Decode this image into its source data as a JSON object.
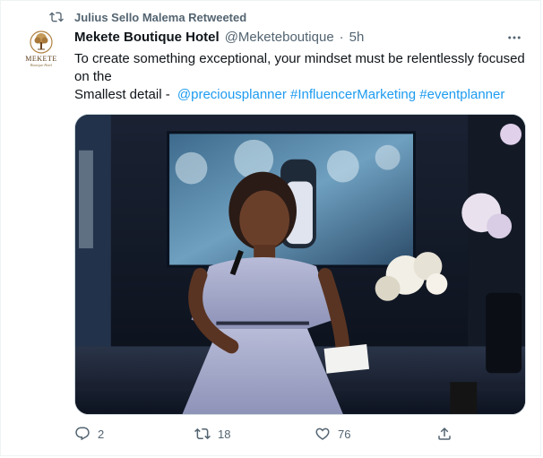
{
  "retweet": {
    "label": "Julius Sello Malema Retweeted",
    "icon": "retweet-icon"
  },
  "tweet": {
    "avatar": {
      "brand": "MEKETE",
      "subtitle": "Boutique Hotel"
    },
    "author_name": "Mekete Boutique Hotel",
    "author_handle": "@Meketeboutique",
    "separator": "·",
    "time": "5h",
    "more_icon": "more-horizontal-icon",
    "text_line1": "To create something exceptional, your mindset must be relentlessly focused on the",
    "text_line2_prefix": "Smallest detail - ",
    "links": [
      "@preciousplanner",
      "#InfluencerMarketing",
      "#eventplanner"
    ],
    "media_description_icon": "photo"
  },
  "actions": {
    "reply": {
      "icon": "reply-icon",
      "count": "2"
    },
    "retweet": {
      "icon": "retweet-icon",
      "count": "18"
    },
    "like": {
      "icon": "heart-icon",
      "count": "76"
    },
    "share": {
      "icon": "share-icon"
    }
  },
  "colors": {
    "link": "#1d9bf0",
    "secondary_text": "#536471",
    "primary_text": "#0f1419",
    "border": "#cfd9de"
  }
}
